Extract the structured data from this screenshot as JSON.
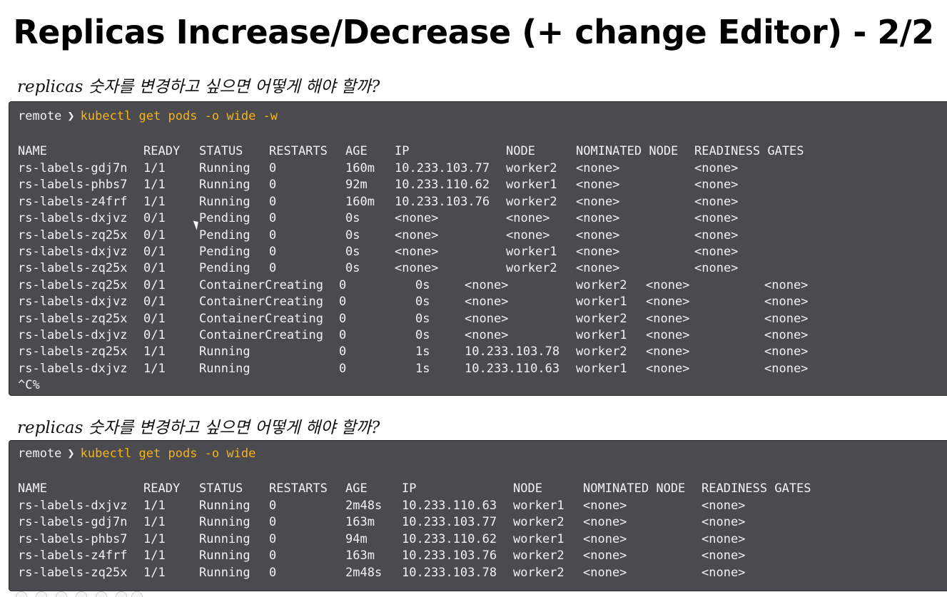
{
  "title": "Replicas Increase/Decrease (+ change Editor) - 2/2",
  "note1": "replicas 숫자를 변경하고 싶으면 어떻게 해야 할까?",
  "note2": "replicas 숫자를 변경하고 싶으면 어떻게 해야 할까?",
  "terminal1": {
    "prompt_host": "remote",
    "prompt_arrow": "❯",
    "command": "kubectl get pods -o wide -w",
    "headers": [
      "NAME",
      "READY",
      "STATUS",
      "RESTARTS",
      "AGE",
      "IP",
      "NODE",
      "NOMINATED NODE",
      "READINESS GATES"
    ],
    "rows": [
      [
        "rs-labels-gdj7n",
        "1/1",
        "Running",
        "0",
        "160m",
        "10.233.103.77",
        "worker2",
        "<none>",
        "<none>"
      ],
      [
        "rs-labels-phbs7",
        "1/1",
        "Running",
        "0",
        "92m",
        "10.233.110.62",
        "worker1",
        "<none>",
        "<none>"
      ],
      [
        "rs-labels-z4frf",
        "1/1",
        "Running",
        "0",
        "160m",
        "10.233.103.76",
        "worker2",
        "<none>",
        "<none>"
      ],
      [
        "rs-labels-dxjvz",
        "0/1",
        "Pending",
        "0",
        "0s",
        "<none>",
        "<none>",
        "<none>",
        "<none>"
      ],
      [
        "rs-labels-zq25x",
        "0/1",
        "Pending",
        "0",
        "0s",
        "<none>",
        "<none>",
        "<none>",
        "<none>"
      ],
      [
        "rs-labels-dxjvz",
        "0/1",
        "Pending",
        "0",
        "0s",
        "<none>",
        "worker1",
        "<none>",
        "<none>"
      ],
      [
        "rs-labels-zq25x",
        "0/1",
        "Pending",
        "0",
        "0s",
        "<none>",
        "worker2",
        "<none>",
        "<none>"
      ],
      [
        "rs-labels-zq25x",
        "0/1",
        "ContainerCreating",
        "0",
        "0s",
        "<none>",
        "worker2",
        "<none>",
        "<none>"
      ],
      [
        "rs-labels-dxjvz",
        "0/1",
        "ContainerCreating",
        "0",
        "0s",
        "<none>",
        "worker1",
        "<none>",
        "<none>"
      ],
      [
        "rs-labels-zq25x",
        "0/1",
        "ContainerCreating",
        "0",
        "0s",
        "<none>",
        "worker2",
        "<none>",
        "<none>"
      ],
      [
        "rs-labels-dxjvz",
        "0/1",
        "ContainerCreating",
        "0",
        "0s",
        "<none>",
        "worker1",
        "<none>",
        "<none>"
      ],
      [
        "rs-labels-zq25x",
        "1/1",
        "Running",
        "0",
        "1s",
        "10.233.103.78",
        "worker2",
        "<none>",
        "<none>"
      ],
      [
        "rs-labels-dxjvz",
        "1/1",
        "Running",
        "0",
        "1s",
        "10.233.110.63",
        "worker1",
        "<none>",
        "<none>"
      ]
    ],
    "interrupt": "^C%"
  },
  "terminal2": {
    "prompt_host": "remote",
    "prompt_arrow": "❯",
    "command": "kubectl get pods -o wide",
    "headers": [
      "NAME",
      "READY",
      "STATUS",
      "RESTARTS",
      "AGE",
      "IP",
      "NODE",
      "NOMINATED NODE",
      "READINESS GATES"
    ],
    "rows": [
      [
        "rs-labels-dxjvz",
        "1/1",
        "Running",
        "0",
        "2m48s",
        "10.233.110.63",
        "worker1",
        "<none>",
        "<none>"
      ],
      [
        "rs-labels-gdj7n",
        "1/1",
        "Running",
        "0",
        "163m",
        "10.233.103.77",
        "worker2",
        "<none>",
        "<none>"
      ],
      [
        "rs-labels-phbs7",
        "1/1",
        "Running",
        "0",
        "94m",
        "10.233.110.62",
        "worker1",
        "<none>",
        "<none>"
      ],
      [
        "rs-labels-z4frf",
        "1/1",
        "Running",
        "0",
        "163m",
        "10.233.103.76",
        "worker2",
        "<none>",
        "<none>"
      ],
      [
        "rs-labels-zq25x",
        "1/1",
        "Running",
        "0",
        "2m48s",
        "10.233.103.78",
        "worker2",
        "<none>",
        "<none>"
      ]
    ]
  },
  "colors": {
    "terminal_bg": "#4b4a4e",
    "terminal_text": "#f2f2f2",
    "command_text": "#f6b31a"
  }
}
